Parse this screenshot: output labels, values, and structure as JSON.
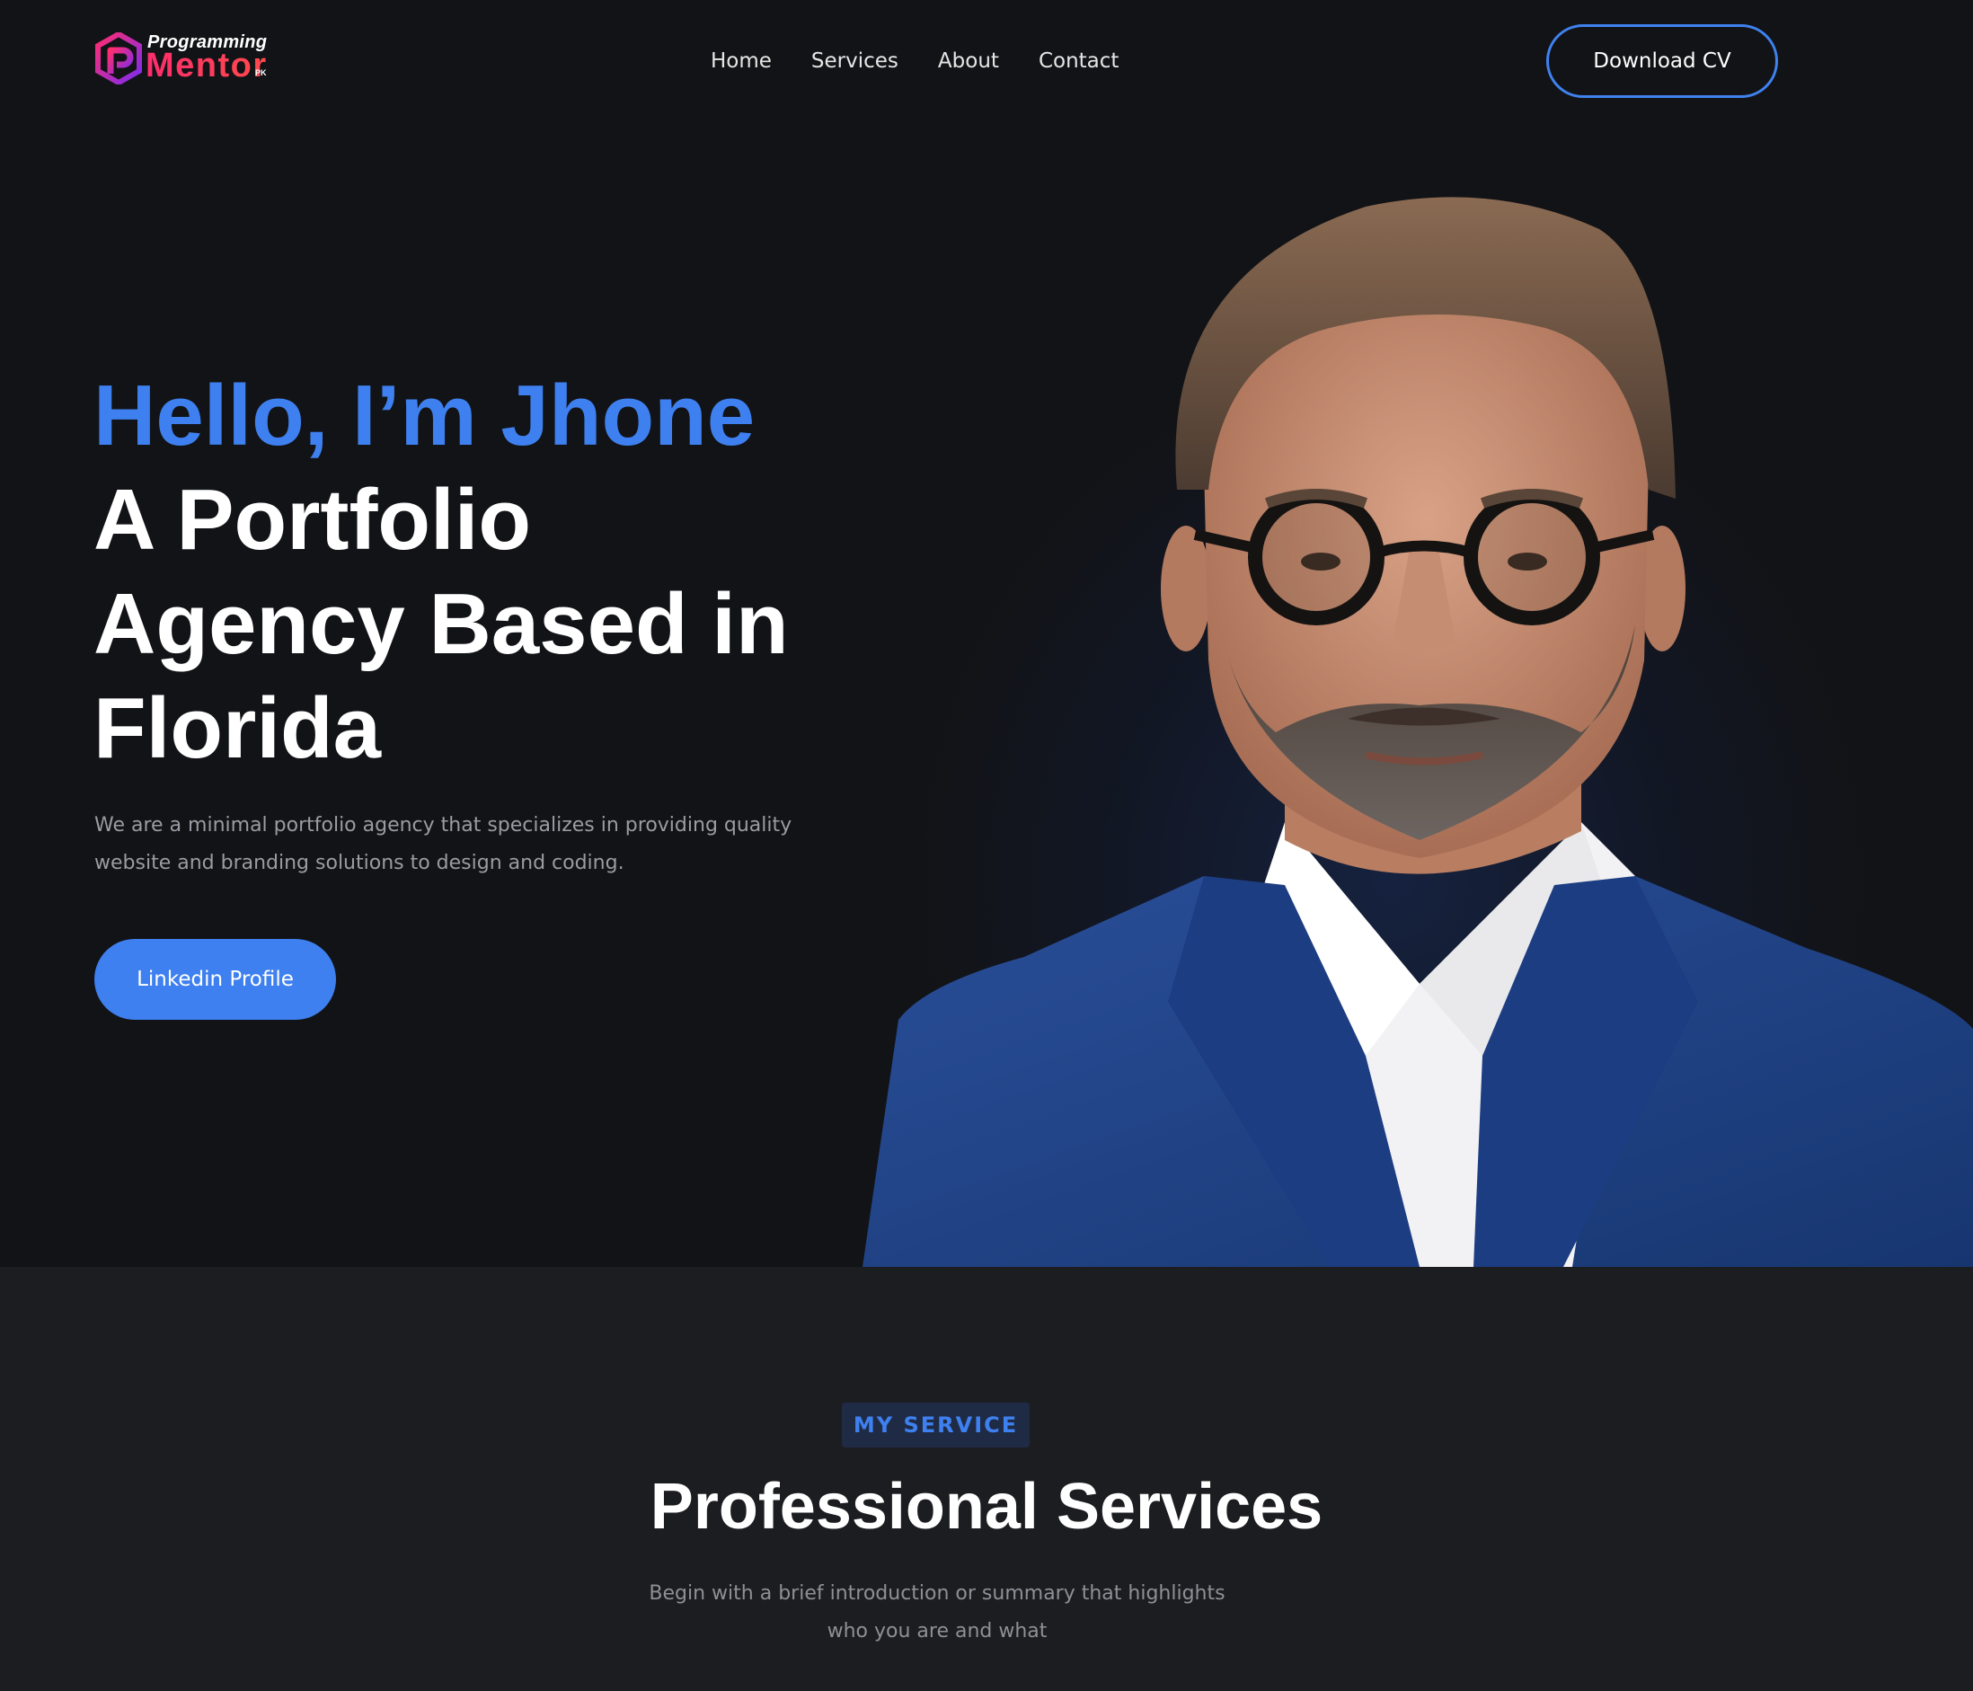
{
  "brand": {
    "logo_top": "Programming",
    "logo_main": "Mentor",
    "logo_suffix": "PK"
  },
  "nav": {
    "items": [
      {
        "label": "Home"
      },
      {
        "label": "Services"
      },
      {
        "label": "About"
      },
      {
        "label": "Contact"
      }
    ],
    "cta_label": "Download CV"
  },
  "hero": {
    "greeting": "Hello, I’m Jhone",
    "title_lines": [
      "A Portfolio",
      "Agency Based in",
      "Florida"
    ],
    "description": "We are a minimal portfolio agency that specializes in providing quality website and branding solutions to design and coding.",
    "button_label": "Linkedin Profile",
    "portrait_icon": "person-portrait-image"
  },
  "services": {
    "badge": "MY SERVICE",
    "title": "Professional Services",
    "description": "Begin with a brief introduction or summary that highlights who you are and what"
  },
  "colors": {
    "accent": "#3e80ef",
    "background": "#121316",
    "section_background": "#1c1d20",
    "logo_pink": "#ff2d6f"
  }
}
